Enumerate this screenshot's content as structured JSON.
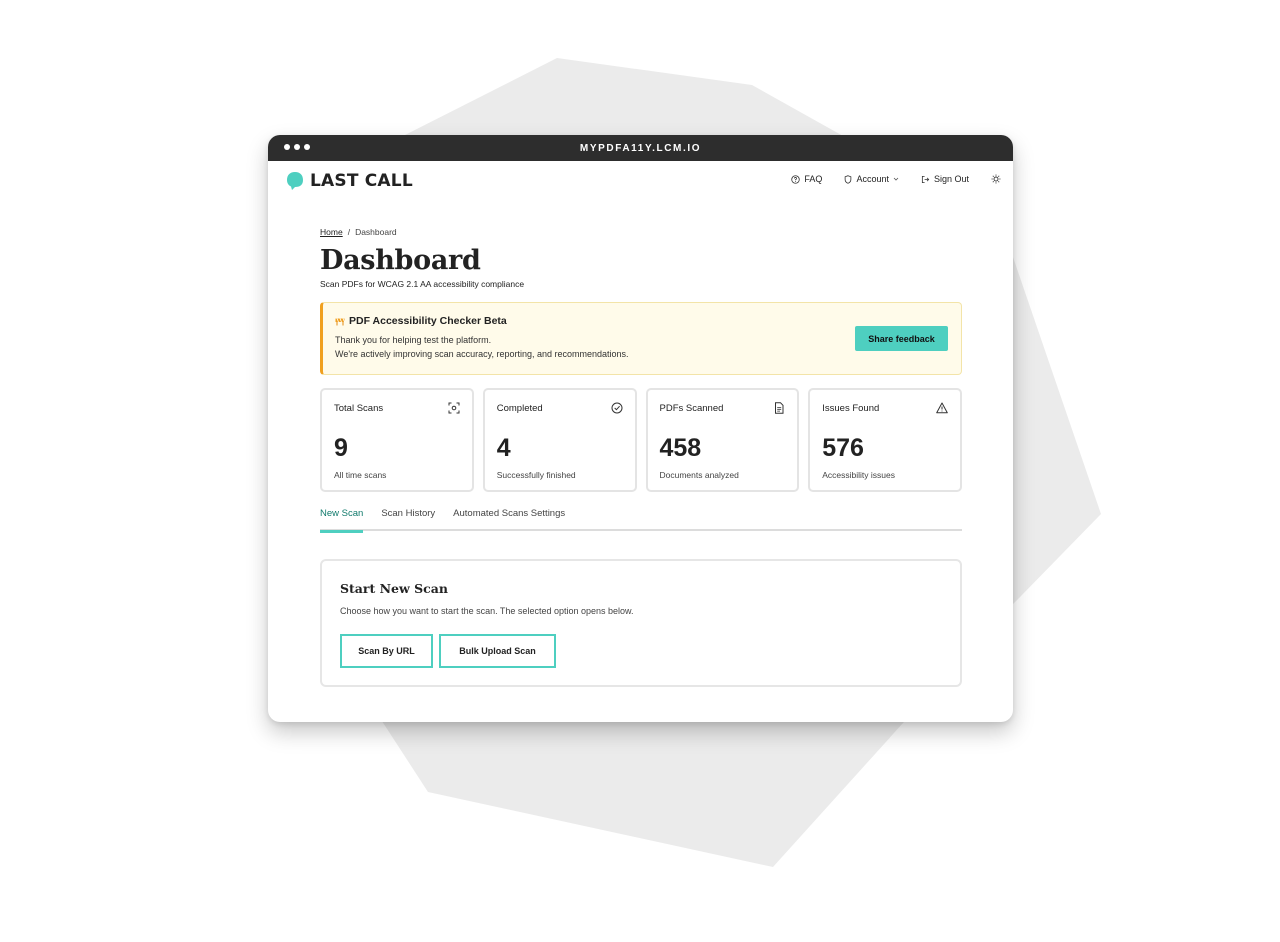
{
  "browser": {
    "url": "MYPDFA11Y.LCM.IO"
  },
  "brand": {
    "name": "LAST CALL",
    "accent": "#4ecfc0",
    "logo_icon": "speech-bubble-icon"
  },
  "nav": {
    "faq": {
      "label": "FAQ",
      "icon": "question-circle-icon"
    },
    "account": {
      "label": "Account",
      "icon": "shield-icon"
    },
    "sign_out": {
      "label": "Sign Out",
      "icon": "sign-out-icon"
    },
    "theme_icon": "sun-icon"
  },
  "breadcrumb": {
    "home": "Home",
    "separator": "/",
    "current": "Dashboard"
  },
  "page": {
    "title": "Dashboard",
    "subtitle": "Scan PDFs for WCAG 2.1 AA accessibility compliance"
  },
  "banner": {
    "icon": "construction-icon",
    "title": "PDF Accessibility Checker Beta",
    "line1": "Thank you for helping test the platform.",
    "line2": "We're actively improving scan accuracy, reporting, and recommendations.",
    "button": "Share feedback",
    "border_color": "#f0a020",
    "background": "#fffbea"
  },
  "stats": [
    {
      "label": "Total Scans",
      "value": "9",
      "sub": "All time scans",
      "icon": "scan-icon"
    },
    {
      "label": "Completed",
      "value": "4",
      "sub": "Successfully finished",
      "icon": "check-circle-icon"
    },
    {
      "label": "PDFs Scanned",
      "value": "458",
      "sub": "Documents analyzed",
      "icon": "document-icon"
    },
    {
      "label": "Issues Found",
      "value": "576",
      "sub": "Accessibility issues",
      "icon": "warning-icon"
    }
  ],
  "tabs": [
    {
      "label": "New Scan",
      "active": true
    },
    {
      "label": "Scan History",
      "active": false
    },
    {
      "label": "Automated Scans Settings",
      "active": false
    }
  ],
  "new_scan": {
    "title": "Start New Scan",
    "description": "Choose how you want to start the scan. The selected option opens below.",
    "url_button": "Scan By URL",
    "bulk_button": "Bulk Upload Scan"
  }
}
